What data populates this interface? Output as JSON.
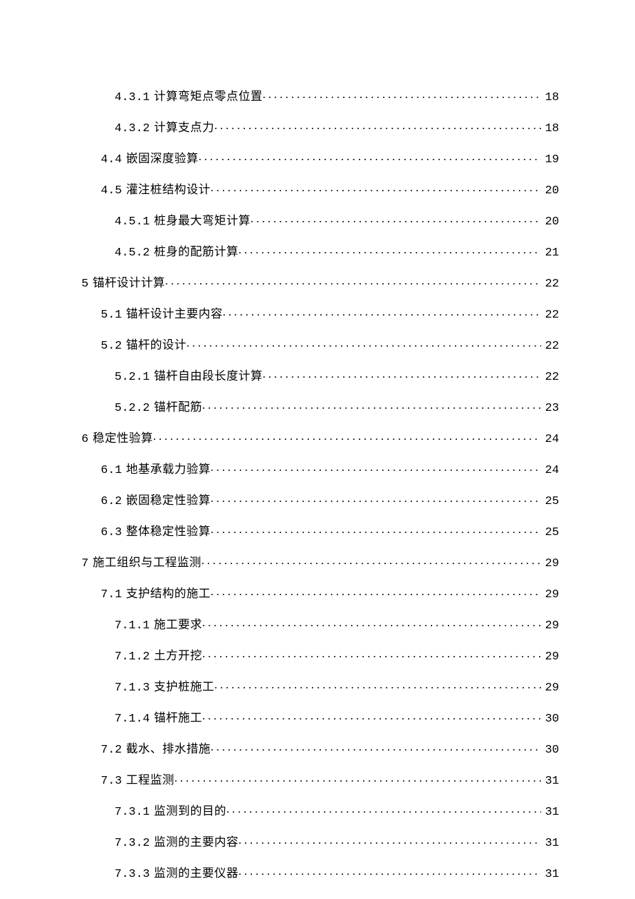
{
  "toc": [
    {
      "level": 3,
      "num": "4.3.1",
      "title": "计算弯矩点零点位置",
      "page": "18"
    },
    {
      "level": 3,
      "num": "4.3.2",
      "title": "计算支点力",
      "page": "18"
    },
    {
      "level": 2,
      "num": "4.4",
      "title": "嵌固深度验算",
      "page": "19"
    },
    {
      "level": 2,
      "num": "4.5",
      "title": "灌注桩结构设计",
      "page": "20"
    },
    {
      "level": 3,
      "num": "4.5.1",
      "title": "桩身最大弯矩计算",
      "page": "20"
    },
    {
      "level": 3,
      "num": "4.5.2",
      "title": "桩身的配筋计算",
      "page": "21"
    },
    {
      "level": 1,
      "num": "5",
      "title": "锚杆设计计算",
      "page": "22"
    },
    {
      "level": 2,
      "num": "5.1",
      "title": "锚杆设计主要内容",
      "page": "22"
    },
    {
      "level": 2,
      "num": "5.2",
      "title": "锚杆的设计",
      "page": "22"
    },
    {
      "level": 3,
      "num": "5.2.1",
      "title": "锚杆自由段长度计算",
      "page": "22"
    },
    {
      "level": 3,
      "num": "5.2.2",
      "title": "锚杆配筋",
      "page": "23"
    },
    {
      "level": 1,
      "num": "6",
      "title": "稳定性验算",
      "page": "24"
    },
    {
      "level": 2,
      "num": "6.1",
      "title": "地基承载力验算",
      "page": "24"
    },
    {
      "level": 2,
      "num": "6.2",
      "title": "嵌固稳定性验算",
      "page": "25"
    },
    {
      "level": 2,
      "num": "6.3",
      "title": "整体稳定性验算",
      "page": "25"
    },
    {
      "level": 1,
      "num": "7",
      "title": "施工组织与工程监测",
      "page": "29"
    },
    {
      "level": 2,
      "num": "7.1",
      "title": "支护结构的施工",
      "page": "29"
    },
    {
      "level": 3,
      "num": "7.1.1",
      "title": "施工要求",
      "page": "29"
    },
    {
      "level": 3,
      "num": "7.1.2",
      "title": "土方开挖",
      "page": "29"
    },
    {
      "level": 3,
      "num": "7.1.3",
      "title": "支护桩施工",
      "page": "29"
    },
    {
      "level": 3,
      "num": "7.1.4",
      "title": "锚杆施工",
      "page": "30"
    },
    {
      "level": 2,
      "num": "7.2",
      "title": "截水、排水措施",
      "page": "30"
    },
    {
      "level": 2,
      "num": "7.3",
      "title": "工程监测",
      "page": "31"
    },
    {
      "level": 3,
      "num": "7.3.1",
      "title": "监测到的目的",
      "page": "31"
    },
    {
      "level": 3,
      "num": "7.3.2",
      "title": "监测的主要内容",
      "page": "31"
    },
    {
      "level": 3,
      "num": "7.3.3",
      "title": "监测的主要仪器",
      "page": "31"
    }
  ]
}
